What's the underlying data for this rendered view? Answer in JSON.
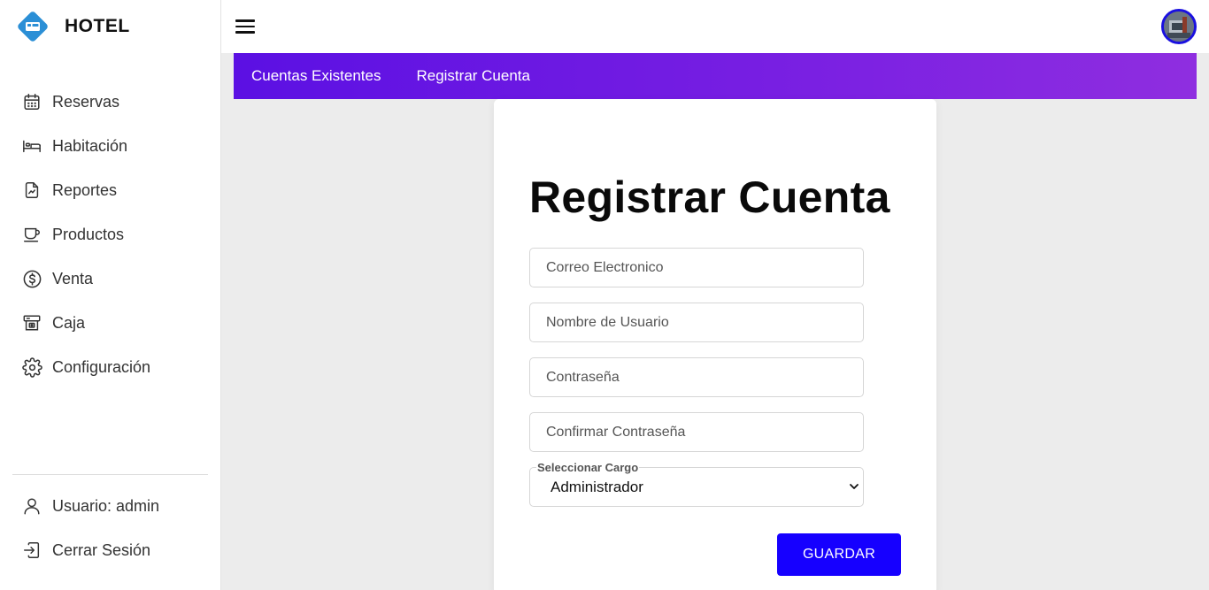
{
  "brand": {
    "name": "HOTEL",
    "logo_icon": "bed-icon",
    "logo_color": "#2b8fd6"
  },
  "sidebar": {
    "items": [
      {
        "label": "Reservas",
        "icon": "calendar-icon"
      },
      {
        "label": "Habitación",
        "icon": "bed-icon"
      },
      {
        "label": "Reportes",
        "icon": "report-icon"
      },
      {
        "label": "Productos",
        "icon": "cup-icon"
      },
      {
        "label": "Venta",
        "icon": "dollar-icon"
      },
      {
        "label": "Caja",
        "icon": "cash-register-icon"
      },
      {
        "label": "Configuración",
        "icon": "gear-icon"
      }
    ],
    "bottom": [
      {
        "label": "Usuario: admin",
        "icon": "user-icon"
      },
      {
        "label": "Cerrar Sesión",
        "icon": "logout-icon"
      }
    ]
  },
  "topbar": {
    "menu_icon": "hamburger-icon",
    "avatar_border_color": "#1a10e0"
  },
  "tabs": [
    {
      "label": "Cuentas Existentes"
    },
    {
      "label": "Registrar Cuenta"
    }
  ],
  "form": {
    "title": "Registrar Cuenta",
    "email_placeholder": "Correo Electronico",
    "username_placeholder": "Nombre de Usuario",
    "password_placeholder": "Contraseña",
    "confirm_placeholder": "Confirmar Contraseña",
    "role_label": "Seleccionar Cargo",
    "role_value": "Administrador",
    "save_label": "GUARDAR"
  },
  "colors": {
    "accent": "#1600ff",
    "tab_gradient_start": "#5b10e3",
    "tab_gradient_end": "#8f2ee0"
  }
}
